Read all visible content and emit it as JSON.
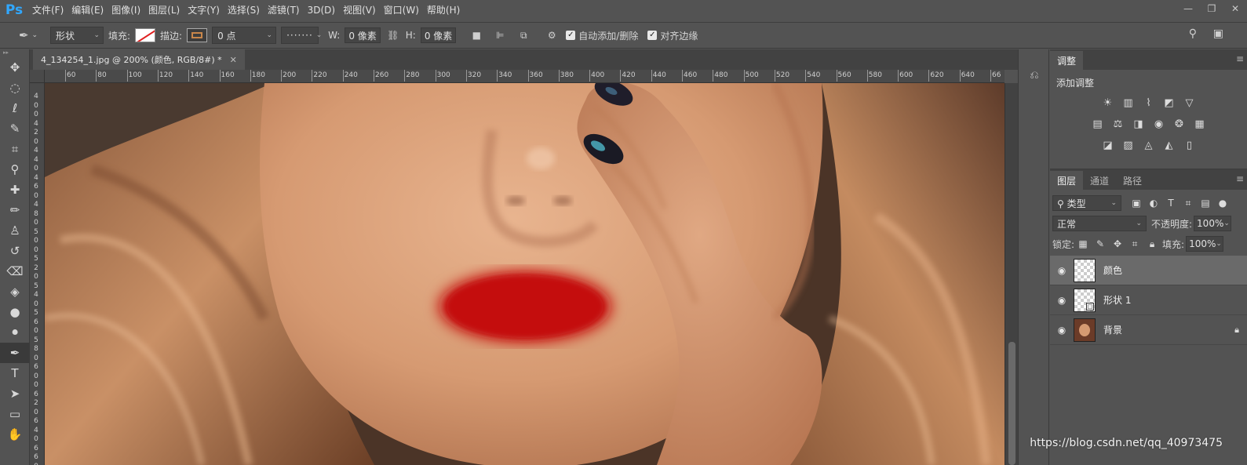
{
  "app": {
    "logo": "Ps"
  },
  "menu": [
    "文件(F)",
    "编辑(E)",
    "图像(I)",
    "图层(L)",
    "文字(Y)",
    "选择(S)",
    "滤镜(T)",
    "3D(D)",
    "视图(V)",
    "窗口(W)",
    "帮助(H)"
  ],
  "window_controls": [
    "minimize-icon",
    "restore-icon",
    "close-icon"
  ],
  "options": {
    "mode_value": "形状",
    "fill_label": "填充:",
    "stroke_label": "描边:",
    "stroke_width_value": "0 点",
    "w_label": "W:",
    "w_value": "0 像素",
    "h_label": "H:",
    "h_value": "0 像素",
    "auto_add_delete_label": "自动添加/删除",
    "align_edges_label": "对齐边缘",
    "fill_color": "#ffffff",
    "stroke_color": "#c8864a"
  },
  "tools": [
    {
      "name": "move-tool",
      "glyph": "✥"
    },
    {
      "name": "marquee-tool",
      "glyph": "◌"
    },
    {
      "name": "lasso-tool",
      "glyph": "ℓ"
    },
    {
      "name": "quick-select-tool",
      "glyph": "✎"
    },
    {
      "name": "crop-tool",
      "glyph": "⌗"
    },
    {
      "name": "eyedropper-tool",
      "glyph": "⚲"
    },
    {
      "name": "healing-brush-tool",
      "glyph": "✚"
    },
    {
      "name": "brush-tool",
      "glyph": "✏"
    },
    {
      "name": "clone-stamp-tool",
      "glyph": "♙"
    },
    {
      "name": "history-brush-tool",
      "glyph": "↺"
    },
    {
      "name": "eraser-tool",
      "glyph": "⌫"
    },
    {
      "name": "paint-bucket-tool",
      "glyph": "◈"
    },
    {
      "name": "blur-tool",
      "glyph": "●"
    },
    {
      "name": "dodge-tool",
      "glyph": "⚫"
    },
    {
      "name": "pen-tool",
      "glyph": "✒"
    },
    {
      "name": "type-tool",
      "glyph": "T"
    },
    {
      "name": "path-select-tool",
      "glyph": "➤"
    },
    {
      "name": "rectangle-tool",
      "glyph": "▭"
    },
    {
      "name": "hand-tool",
      "glyph": "✋"
    }
  ],
  "document": {
    "tab_title": "4_134254_1.jpg @ 200% (颜色, RGB/8#) *",
    "ruler_h": [
      "60",
      "80",
      "100",
      "120",
      "140",
      "160",
      "180",
      "200",
      "220",
      "240",
      "260",
      "280",
      "300",
      "320",
      "340",
      "360",
      "380",
      "400",
      "420",
      "440",
      "460",
      "480",
      "500",
      "520",
      "540",
      "560",
      "580",
      "600",
      "620",
      "640",
      "66"
    ],
    "ruler_v": [
      "4",
      "0",
      "0",
      "4",
      "2",
      "0",
      "4",
      "4",
      "0",
      "4",
      "6",
      "0",
      "4",
      "8",
      "0",
      "5",
      "0",
      "0",
      "5",
      "2",
      "0",
      "5",
      "4",
      "0",
      "5",
      "6",
      "0",
      "5",
      "8",
      "0",
      "6",
      "0",
      "0",
      "6",
      "2",
      "0",
      "6",
      "4",
      "0",
      "6",
      "6",
      "0"
    ],
    "lip_color": "#c40b0b"
  },
  "adjustments": {
    "tab_label": "调整",
    "title": "添加调整",
    "rows": [
      [
        "brightness-icon",
        "levels-icon",
        "curves-icon",
        "exposure-icon",
        "vibrance-icon"
      ],
      [
        "hue-saturation-icon",
        "color-balance-icon",
        "black-white-icon",
        "photo-filter-icon",
        "channel-mixer-icon",
        "color-lookup-icon"
      ],
      [
        "invert-icon",
        "posterize-icon",
        "threshold-icon",
        "selective-color-icon",
        "gradient-map-icon"
      ]
    ],
    "glyphs": [
      [
        "☀",
        "▥",
        "⌇",
        "◩",
        "▽"
      ],
      [
        "▤",
        "⚖",
        "◨",
        "◉",
        "❂",
        "▦"
      ],
      [
        "◪",
        "▨",
        "◬",
        "◭",
        "▯"
      ]
    ]
  },
  "layers_panel": {
    "tabs": [
      "图层",
      "通道",
      "路径"
    ],
    "filter_kind": "类型",
    "blend_mode": "正常",
    "opacity_label": "不透明度:",
    "opacity_value": "100%",
    "lock_label": "锁定:",
    "fill_label": "填充:",
    "fill_value": "100%",
    "layers": [
      {
        "name": "颜色",
        "selected": true,
        "kind": "transparent",
        "locked": false
      },
      {
        "name": "形状 1",
        "selected": false,
        "kind": "shape",
        "locked": false
      },
      {
        "name": "背景",
        "selected": false,
        "kind": "photo",
        "locked": true
      }
    ]
  },
  "watermark": "https://blog.csdn.net/qq_40973475"
}
